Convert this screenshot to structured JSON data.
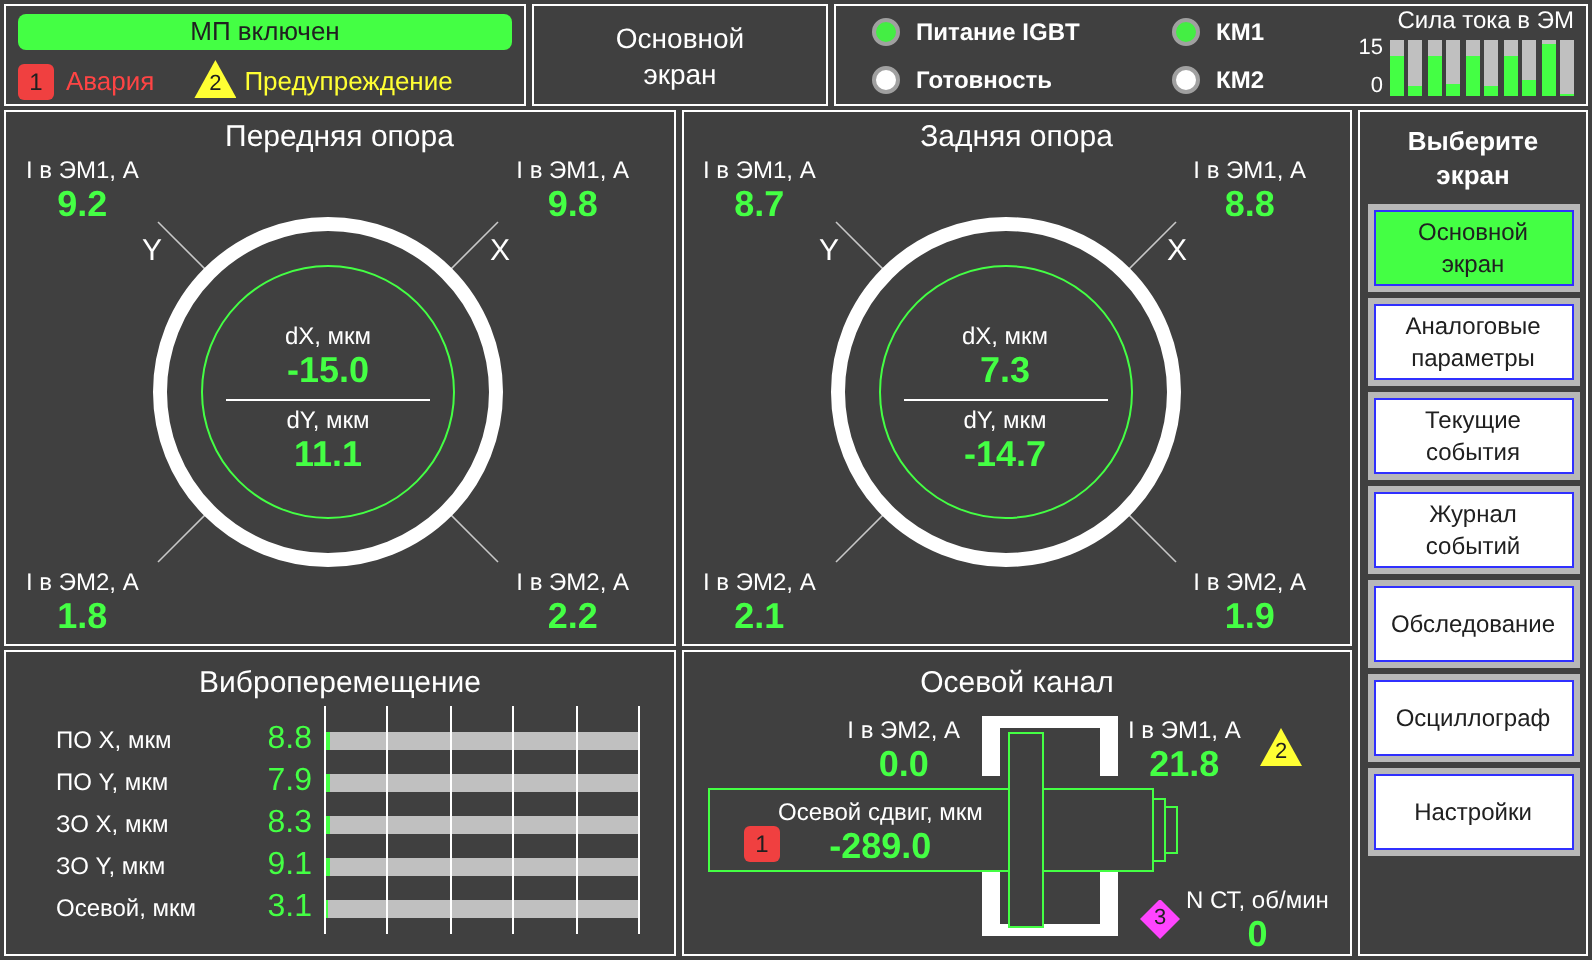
{
  "status": {
    "banner": "МП включен",
    "alarm": {
      "badge": "1",
      "label": "Авария"
    },
    "warning": {
      "badge": "2",
      "label": "Предупреждение"
    }
  },
  "current_screen": "Основной\nэкран",
  "indicators": [
    {
      "label": "Питание IGBT",
      "on": true
    },
    {
      "label": "КМ1",
      "on": true
    },
    {
      "label": "Готовность",
      "on": false
    },
    {
      "label": "КМ2",
      "on": false
    }
  ],
  "current_meters": {
    "title": "Сила тока в ЭМ",
    "scale_max": "15",
    "scale_min": "0",
    "meters": [
      {
        "level": 0.7
      },
      {
        "level": 0.17
      },
      {
        "level": 0.73
      },
      {
        "level": 0.2
      },
      {
        "level": 0.7
      },
      {
        "level": 0.17
      },
      {
        "level": 0.7
      },
      {
        "level": 0.3
      },
      {
        "level": 0.93
      },
      {
        "level": 0
      }
    ]
  },
  "bearings": [
    {
      "title": "Передняя опора",
      "axis_left": "Y",
      "axis_right": "X",
      "top_left": {
        "label": "I в ЭМ1, А",
        "value": "9.2"
      },
      "top_right": {
        "label": "I в ЭМ1, А",
        "value": "9.8"
      },
      "dx": {
        "label": "dX, мкм",
        "value": "-15.0"
      },
      "dy": {
        "label": "dY, мкм",
        "value": "11.1"
      },
      "bottom_left": {
        "label": "I в ЭМ2, А",
        "value": "1.8"
      },
      "bottom_right": {
        "label": "I в ЭМ2, А",
        "value": "2.2"
      }
    },
    {
      "title": "Задняя опора",
      "axis_left": "Y",
      "axis_right": "X",
      "top_left": {
        "label": "I в ЭМ1, А",
        "value": "8.7"
      },
      "top_right": {
        "label": "I в ЭМ1, А",
        "value": "8.8"
      },
      "dx": {
        "label": "dX, мкм",
        "value": "7.3"
      },
      "dy": {
        "label": "dY, мкм",
        "value": "-14.7"
      },
      "bottom_left": {
        "label": "I в ЭМ2, А",
        "value": "2.1"
      },
      "bottom_right": {
        "label": "I в ЭМ2, А",
        "value": "1.9"
      }
    }
  ],
  "vibration": {
    "title": "Виброперемещение",
    "rows": [
      {
        "label": "ПО X, мкм",
        "value": "8.8",
        "level": 0.02
      },
      {
        "label": "ПО Y, мкм",
        "value": "7.9",
        "level": 0.02
      },
      {
        "label": "ЗО X, мкм",
        "value": "8.3",
        "level": 0.02
      },
      {
        "label": "ЗО Y, мкм",
        "value": "9.1",
        "level": 0.02
      },
      {
        "label": "Осевой, мкм",
        "value": "3.1",
        "level": 0.01
      }
    ]
  },
  "axial": {
    "title": "Осевой канал",
    "em2": {
      "label": "I в ЭМ2, А",
      "value": "0.0"
    },
    "em1": {
      "label": "I в ЭМ1, А",
      "value": "21.8",
      "badge": "2"
    },
    "shift": {
      "label": "Осевой сдвиг, мкм",
      "value": "-289.0",
      "badge": "1"
    },
    "speed": {
      "label": "N СТ, об/мин",
      "value": "0",
      "badge": "3"
    }
  },
  "sidebar": {
    "title": "Выберите\nэкран",
    "buttons": [
      {
        "label": "Основной\nэкран",
        "selected": true
      },
      {
        "label": "Аналоговые\nпараметры",
        "selected": false
      },
      {
        "label": "Текущие\nсобытия",
        "selected": false
      },
      {
        "label": "Журнал\nсобытий",
        "selected": false
      },
      {
        "label": "Обследование",
        "selected": false
      },
      {
        "label": "Осциллограф",
        "selected": false
      },
      {
        "label": "Настройки",
        "selected": false
      }
    ]
  }
}
